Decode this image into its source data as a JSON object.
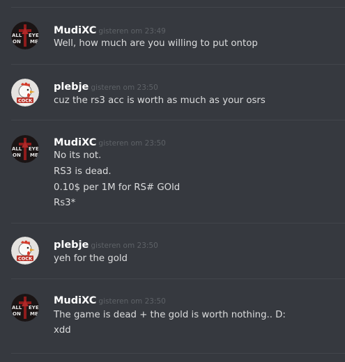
{
  "messages": [
    {
      "author": "MudiXC",
      "avatar": "illuminati-avatar-icon",
      "timestamp": "gisteren om 23:49",
      "lines": [
        "Well, how much are you willing to put ontop"
      ]
    },
    {
      "author": "plebje",
      "avatar": "rooster-cock-avatar-icon",
      "timestamp": "gisteren om 23:50",
      "lines": [
        "cuz the rs3 acc is worth as much as your osrs"
      ]
    },
    {
      "author": "MudiXC",
      "avatar": "illuminati-avatar-icon",
      "timestamp": "gisteren om 23:50",
      "lines": [
        "No its not.",
        "RS3 is dead.",
        "0.10$ per 1M for RS# GOld",
        "Rs3*"
      ]
    },
    {
      "author": "plebje",
      "avatar": "rooster-cock-avatar-icon",
      "timestamp": "gisteren om 23:50",
      "lines": [
        "yeh for the gold"
      ]
    },
    {
      "author": "MudiXC",
      "avatar": "illuminati-avatar-icon",
      "timestamp": "gisteren om 23:50",
      "lines": [
        "The game is dead + the gold is worth nothing.. D:",
        "xdd"
      ]
    }
  ],
  "colors": {
    "background": "#36393f",
    "divider": "#42454b",
    "username": "#ffffff",
    "timestamp": "#5e6267",
    "text": "#dcddde"
  }
}
